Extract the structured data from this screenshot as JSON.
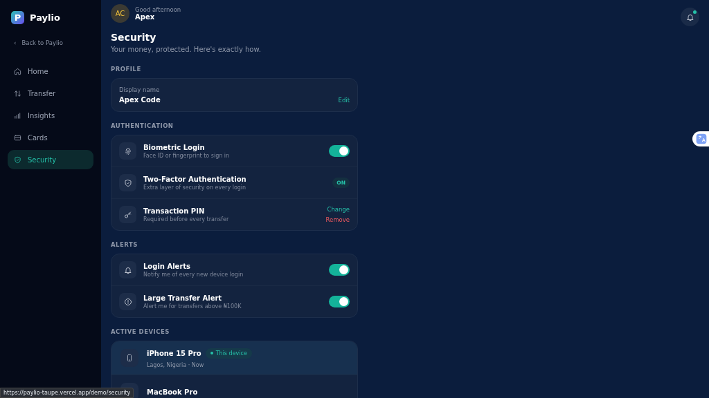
{
  "brand": {
    "name": "Paylio",
    "logo_letter": "P"
  },
  "back_link": {
    "label": "Back to Paylio",
    "arrow": "‹"
  },
  "nav": [
    {
      "label": "Home",
      "selected": false
    },
    {
      "label": "Transfer",
      "selected": false
    },
    {
      "label": "Insights",
      "selected": false
    },
    {
      "label": "Cards",
      "selected": false
    },
    {
      "label": "Security",
      "selected": true
    }
  ],
  "header": {
    "initials": "AC",
    "greeting": "Good afternoon",
    "name": "Apex",
    "notification_unread": true
  },
  "page": {
    "title": "Security",
    "subtitle": "Your money, protected. Here's exactly how."
  },
  "profile": {
    "heading": "PROFILE",
    "field_label": "Display name",
    "field_value": "Apex Code",
    "action": "Edit"
  },
  "sections": [
    {
      "heading": "AUTHENTICATION",
      "rows": [
        {
          "kind": "toggle",
          "title": "Biometric Login",
          "subtitle": "Face ID or fingerprint to sign in",
          "on": true
        },
        {
          "kind": "badge",
          "title": "Two-Factor Authentication",
          "subtitle": "Extra layer of security on every login",
          "badge": "ON"
        },
        {
          "kind": "actions",
          "title": "Transaction PIN",
          "subtitle": "Required before every transfer",
          "actions": [
            "Change",
            "Remove"
          ]
        }
      ]
    },
    {
      "heading": "ALERTS",
      "rows": [
        {
          "kind": "toggle",
          "title": "Login Alerts",
          "subtitle": "Notify me of every new device login",
          "on": true
        },
        {
          "kind": "toggle",
          "title": "Large Transfer Alert",
          "subtitle": "Alert me for transfers above ₦100K",
          "on": true
        }
      ]
    }
  ],
  "devices": {
    "heading": "ACTIVE DEVICES",
    "items": [
      {
        "name": "iPhone 15 Pro",
        "badge": "This device",
        "detail": "Lagos, Nigeria · Now",
        "current": true
      },
      {
        "name": "MacBook Pro",
        "current": false
      }
    ]
  },
  "status_url": "https://paylio-taupe.vercel.app/demo/security"
}
